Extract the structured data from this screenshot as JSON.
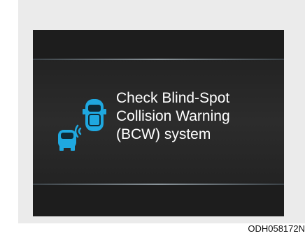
{
  "display": {
    "message_lines": [
      "Check Blind-Spot",
      "Collision Warning",
      "(BCW) system"
    ],
    "icon": "blind-spot-collision-warning-icon"
  },
  "figure_code": "ODH058172N",
  "colors": {
    "panel": "#ebebeb",
    "screen": "#1d1d1d",
    "text": "#ffffff",
    "icon_accent": "#1fa8e0"
  }
}
